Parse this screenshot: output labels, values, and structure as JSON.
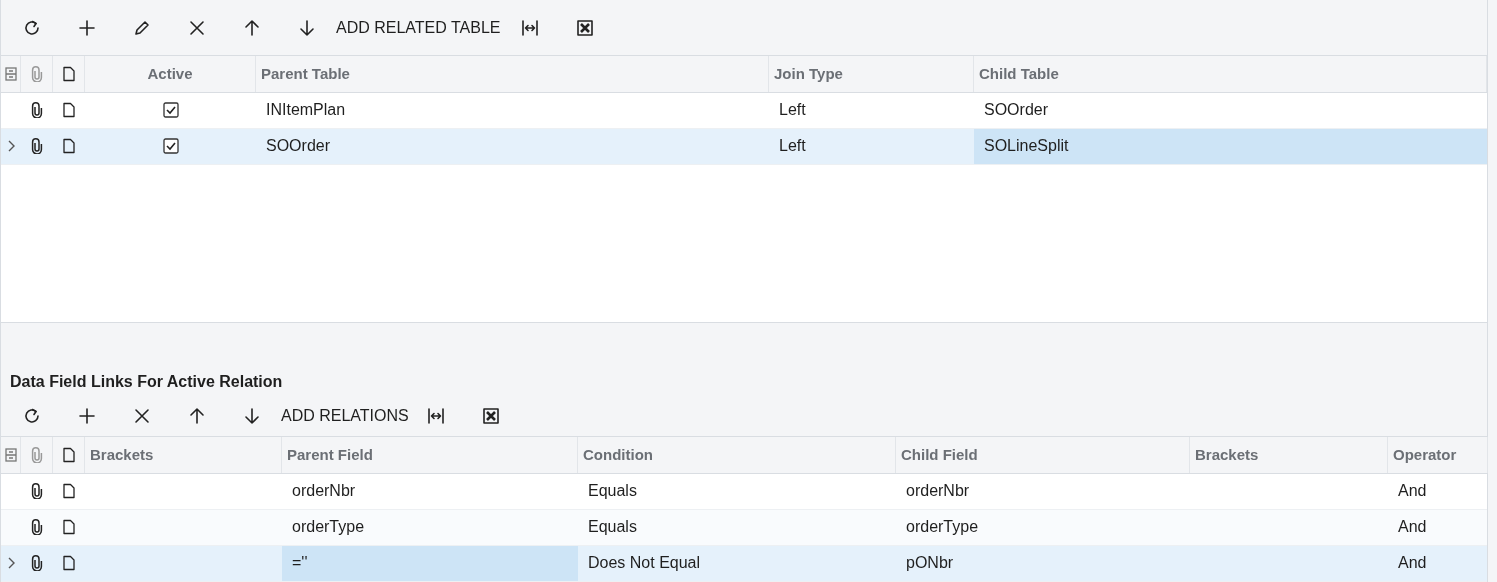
{
  "relations": {
    "toolbar_action": "ADD RELATED TABLE",
    "columns": [
      "Active",
      "Parent Table",
      "Join Type",
      "Child Table"
    ],
    "rows": [
      {
        "selected": false,
        "cells": [
          {
            "kind": "checkbox",
            "checked": true
          },
          {
            "text": "INItemPlan",
            "focused": false
          },
          {
            "text": "Left",
            "focused": false
          },
          {
            "text": "SOOrder",
            "focused": false
          }
        ]
      },
      {
        "selected": true,
        "cells": [
          {
            "kind": "checkbox",
            "checked": true
          },
          {
            "text": "SOOrder",
            "focused": false
          },
          {
            "text": "Left",
            "focused": false
          },
          {
            "text": "SOLineSplit",
            "focused": true
          }
        ]
      }
    ]
  },
  "links": {
    "title": "Data Field Links For Active Relation",
    "toolbar_action": "ADD RELATIONS",
    "columns": [
      "Brackets",
      "Parent Field",
      "Condition",
      "Child Field",
      "Brackets",
      "Operator"
    ],
    "rows": [
      {
        "selected": false,
        "cells": [
          {
            "text": "",
            "focused": false
          },
          {
            "text": "orderNbr",
            "focused": false
          },
          {
            "text": "Equals",
            "focused": false
          },
          {
            "text": "orderNbr",
            "focused": false
          },
          {
            "text": "",
            "focused": false
          },
          {
            "text": "And",
            "focused": false
          }
        ]
      },
      {
        "selected": false,
        "cells": [
          {
            "text": "",
            "focused": false
          },
          {
            "text": "orderType",
            "focused": false
          },
          {
            "text": "Equals",
            "focused": false
          },
          {
            "text": "orderType",
            "focused": false
          },
          {
            "text": "",
            "focused": false
          },
          {
            "text": "And",
            "focused": false
          }
        ]
      },
      {
        "selected": true,
        "cells": [
          {
            "text": "",
            "focused": false
          },
          {
            "text": "=''",
            "focused": true
          },
          {
            "text": "Does Not Equal",
            "focused": false
          },
          {
            "text": "pONbr",
            "focused": false
          },
          {
            "text": "",
            "focused": false
          },
          {
            "text": "And",
            "focused": false
          }
        ]
      }
    ]
  }
}
